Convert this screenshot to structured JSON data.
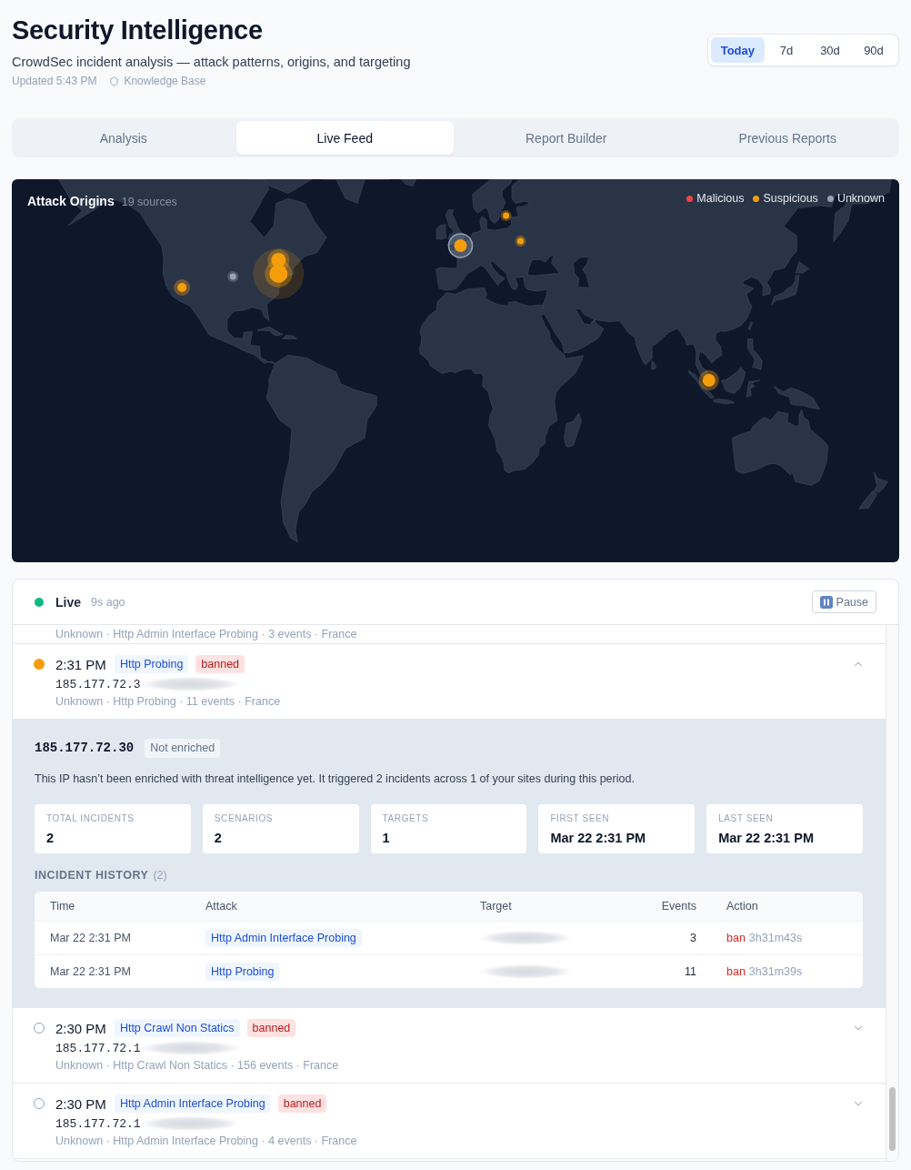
{
  "header": {
    "title": "Security Intelligence",
    "subtitle": "CrowdSec incident analysis — attack patterns, origins, and targeting",
    "updated": "Updated 5:43 PM",
    "link": "Knowledge Base"
  },
  "ranges": [
    {
      "label": "Today",
      "selected": true
    },
    {
      "label": "7d",
      "selected": false
    },
    {
      "label": "30d",
      "selected": false
    },
    {
      "label": "90d",
      "selected": false
    }
  ],
  "tabs": [
    {
      "label": "Analysis",
      "selected": false
    },
    {
      "label": "Live Feed",
      "selected": true
    },
    {
      "label": "Report Builder",
      "selected": false
    },
    {
      "label": "Previous Reports",
      "selected": false
    }
  ],
  "map": {
    "title": "Attack Origins",
    "count": "19 sources",
    "legend": [
      {
        "label": "Malicious",
        "color": "#ef4444"
      },
      {
        "label": "Suspicious",
        "color": "#f59e0b"
      },
      {
        "label": "Unknown",
        "color": "#94a3b8"
      }
    ]
  },
  "feed": {
    "status": "Live",
    "live": true,
    "age": "9s ago",
    "pause": "Pause",
    "cut_row_meta": "Unknown · Http Admin Interface Probing · 3 events · France",
    "events": [
      {
        "time": "2:31 PM",
        "scenario": "Http Probing",
        "action": "banned",
        "ip": "185.177.72.3",
        "meta": "Unknown · Http Probing · 11 events · France",
        "expanded": true,
        "detail": {
          "ip": "185.177.72.30",
          "badge": "Not enriched",
          "text": "This IP hasn’t been enriched with threat intelligence yet. It triggered 2 incidents across 1 of your sites during this period.",
          "stats": [
            {
              "label": "TOTAL INCIDENTS",
              "value": "2"
            },
            {
              "label": "SCENARIOS",
              "value": "2"
            },
            {
              "label": "TARGETS",
              "value": "1"
            },
            {
              "label": "FIRST SEEN",
              "value": "Mar 22 2:31 PM"
            },
            {
              "label": "LAST SEEN",
              "value": "Mar 22 2:31 PM"
            }
          ],
          "history_title": "INCIDENT HISTORY",
          "history_count": "(2)",
          "columns": [
            "Time",
            "Attack",
            "Target",
            "Events",
            "Action"
          ],
          "rows": [
            {
              "time": "Mar 22 2:31 PM",
              "attack": "Http Admin Interface Probing",
              "events": "3",
              "action": "ban",
              "duration": "3h31m43s"
            },
            {
              "time": "Mar 22 2:31 PM",
              "attack": "Http Probing",
              "events": "11",
              "action": "ban",
              "duration": "3h31m39s"
            }
          ]
        }
      },
      {
        "time": "2:30 PM",
        "scenario": "Http Crawl Non Statics",
        "action": "banned",
        "ip": "185.177.72.1",
        "meta": "Unknown · Http Crawl Non Statics · 156 events · France",
        "expanded": false
      },
      {
        "time": "2:30 PM",
        "scenario": "Http Admin Interface Probing",
        "action": "banned",
        "ip": "185.177.72.1",
        "meta": "Unknown · Http Admin Interface Probing · 4 events · France",
        "expanded": false
      }
    ]
  }
}
